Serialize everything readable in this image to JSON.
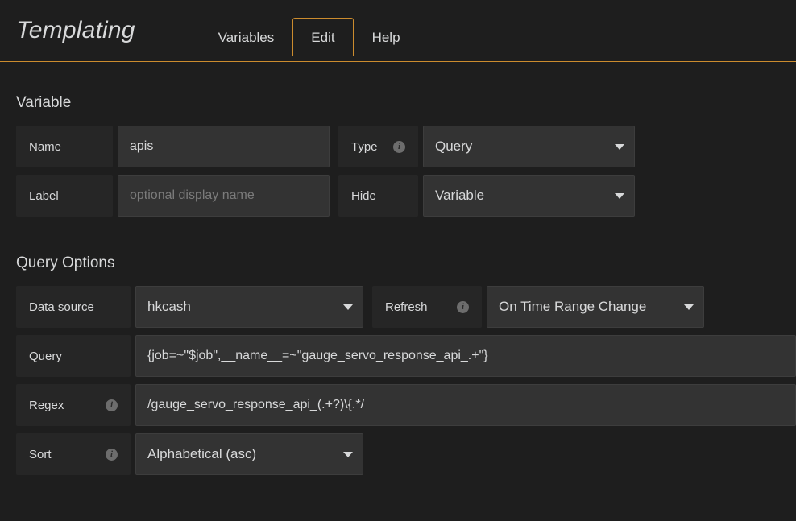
{
  "header": {
    "title": "Templating",
    "tabs": [
      {
        "label": "Variables",
        "active": false
      },
      {
        "label": "Edit",
        "active": true
      },
      {
        "label": "Help",
        "active": false
      }
    ]
  },
  "variable_section": {
    "title": "Variable",
    "name": {
      "label": "Name",
      "value": "apis"
    },
    "type": {
      "label": "Type",
      "value": "Query",
      "has_info": true
    },
    "label_field": {
      "label": "Label",
      "value": "",
      "placeholder": "optional display name"
    },
    "hide": {
      "label": "Hide",
      "value": "Variable",
      "has_info": false
    }
  },
  "query_options_section": {
    "title": "Query Options",
    "data_source": {
      "label": "Data source",
      "value": "hkcash"
    },
    "refresh": {
      "label": "Refresh",
      "value": "On Time Range Change",
      "has_info": true
    },
    "query": {
      "label": "Query",
      "value": "{job=~\"$job\",__name__=~\"gauge_servo_response_api_.+\"}"
    },
    "regex": {
      "label": "Regex",
      "value": "/gauge_servo_response_api_(.+?)\\{.*/",
      "has_info": true
    },
    "sort": {
      "label": "Sort",
      "value": "Alphabetical (asc)",
      "has_info": true
    }
  },
  "icons": {
    "info": "i",
    "caret_down": "chevron-down-icon"
  },
  "colors": {
    "background": "#1e1e1e",
    "accent": "#cc8c2e",
    "input_bg": "#333333",
    "label_bg": "#262626",
    "text": "#d8d9da",
    "placeholder": "#7b7b7b"
  }
}
